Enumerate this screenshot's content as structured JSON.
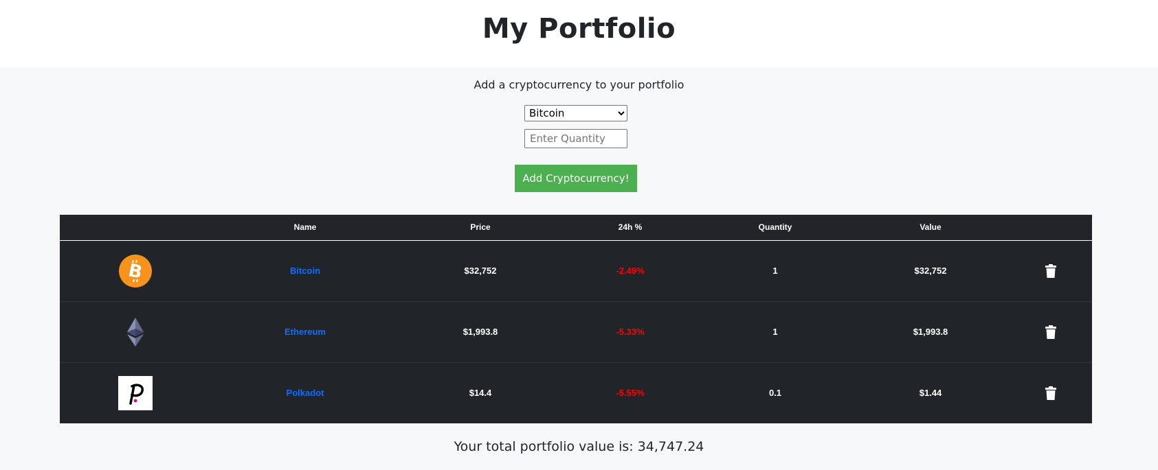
{
  "header": {
    "title": "My Portfolio"
  },
  "form": {
    "prompt": "Add a cryptocurrency to your portfolio",
    "select_value": "Bitcoin",
    "quantity_placeholder": "Enter Quantity",
    "add_button_label": "Add Cryptocurrency!",
    "button_color": "#4caf50"
  },
  "table": {
    "columns": [
      "",
      "Name",
      "Price",
      "24h %",
      "Quantity",
      "Value",
      ""
    ],
    "rows": [
      {
        "icon": "bitcoin-logo-icon",
        "name": "Bitcoin",
        "price": "$32,752",
        "change": "-2.49%",
        "quantity": "1",
        "value": "$32,752"
      },
      {
        "icon": "ethereum-logo-icon",
        "name": "Ethereum",
        "price": "$1,993.8",
        "change": "-5.33%",
        "quantity": "1",
        "value": "$1,993.8"
      },
      {
        "icon": "polkadot-logo-icon",
        "name": "Polkadot",
        "price": "$14.4",
        "change": "-5.55%",
        "quantity": "0.1",
        "value": "$1.44"
      }
    ],
    "colors": {
      "background": "#212529",
      "link": "#0d6efd",
      "negative": "#ff0000"
    }
  },
  "footer": {
    "total_text": "Your total portfolio value is: 34,747.24"
  }
}
